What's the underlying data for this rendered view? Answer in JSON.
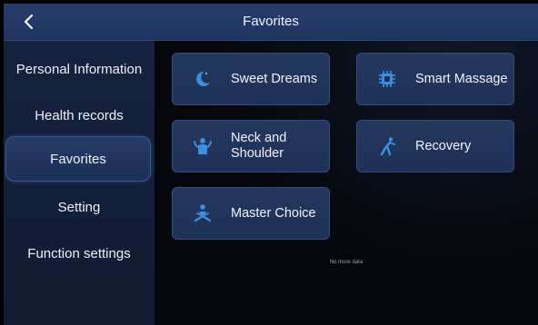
{
  "header": {
    "title": "Favorites",
    "back_icon": "chevron-left-icon"
  },
  "sidebar": {
    "items": [
      {
        "label": "Personal Information",
        "active": false
      },
      {
        "label": "Health records",
        "active": false
      },
      {
        "label": "Favorites",
        "active": true
      },
      {
        "label": "Setting",
        "active": false
      },
      {
        "label": "Function settings",
        "active": false
      }
    ]
  },
  "favorites": {
    "cards": [
      {
        "label": "Sweet Dreams",
        "icon": "moon-icon"
      },
      {
        "label": "Smart Massage",
        "icon": "chip-icon"
      },
      {
        "label": "Neck and Shoulder",
        "icon": "person-shoulder-icon"
      },
      {
        "label": "Recovery",
        "icon": "stretching-person-icon"
      },
      {
        "label": "Master Choice",
        "icon": "seated-person-icon"
      }
    ],
    "empty_note": "No more data"
  },
  "colors": {
    "accent": "#3b8fe0",
    "header_bg": "#22396a",
    "card_bg": "#22365c"
  }
}
